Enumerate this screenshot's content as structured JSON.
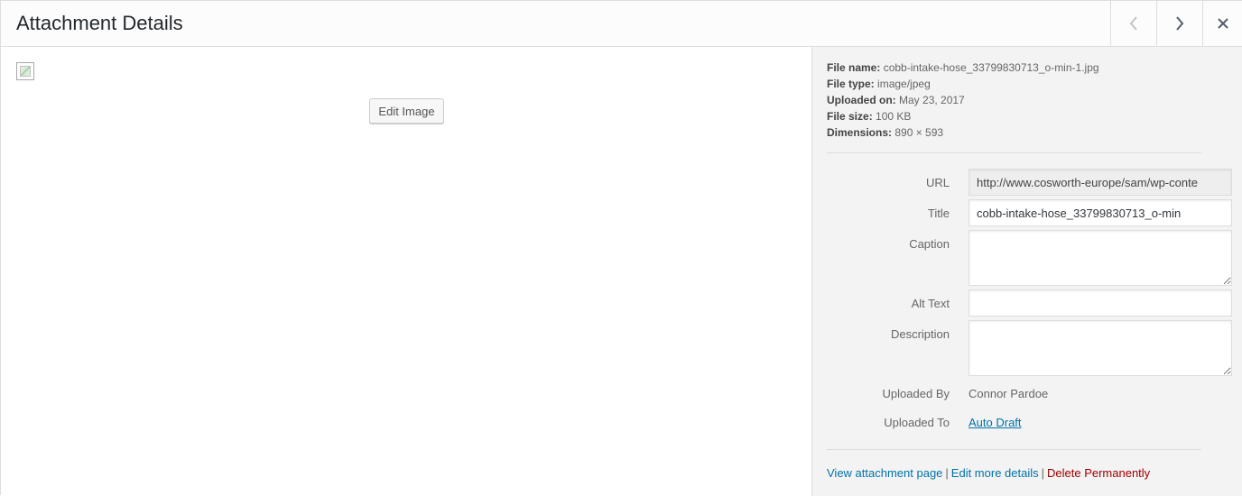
{
  "header": {
    "title": "Attachment Details",
    "prev_icon": "chevron-left-icon",
    "next_icon": "chevron-right-icon",
    "close_icon": "close-icon"
  },
  "preview": {
    "edit_image_label": "Edit Image"
  },
  "meta": {
    "file_name_label": "File name:",
    "file_name": "cobb-intake-hose_33799830713_o-min-1.jpg",
    "file_type_label": "File type:",
    "file_type": "image/jpeg",
    "uploaded_on_label": "Uploaded on:",
    "uploaded_on": "May 23, 2017",
    "file_size_label": "File size:",
    "file_size": "100 KB",
    "dimensions_label": "Dimensions:",
    "dimensions": "890 × 593"
  },
  "fields": {
    "url_label": "URL",
    "url_value": "http://www.cosworth-europe/sam/wp-conte",
    "title_label": "Title",
    "title_value": "cobb-intake-hose_33799830713_o-min",
    "caption_label": "Caption",
    "caption_value": "",
    "alt_label": "Alt Text",
    "alt_value": "",
    "description_label": "Description",
    "description_value": "",
    "uploaded_by_label": "Uploaded By",
    "uploaded_by": "Connor Pardoe",
    "uploaded_to_label": "Uploaded To",
    "uploaded_to": "Auto Draft"
  },
  "actions": {
    "view_page": "View attachment page",
    "edit_details": "Edit more details",
    "delete": "Delete Permanently",
    "separator": "|"
  },
  "colors": {
    "link": "#0073aa",
    "delete": "#a00000",
    "sidebar_bg": "#f3f3f3"
  }
}
